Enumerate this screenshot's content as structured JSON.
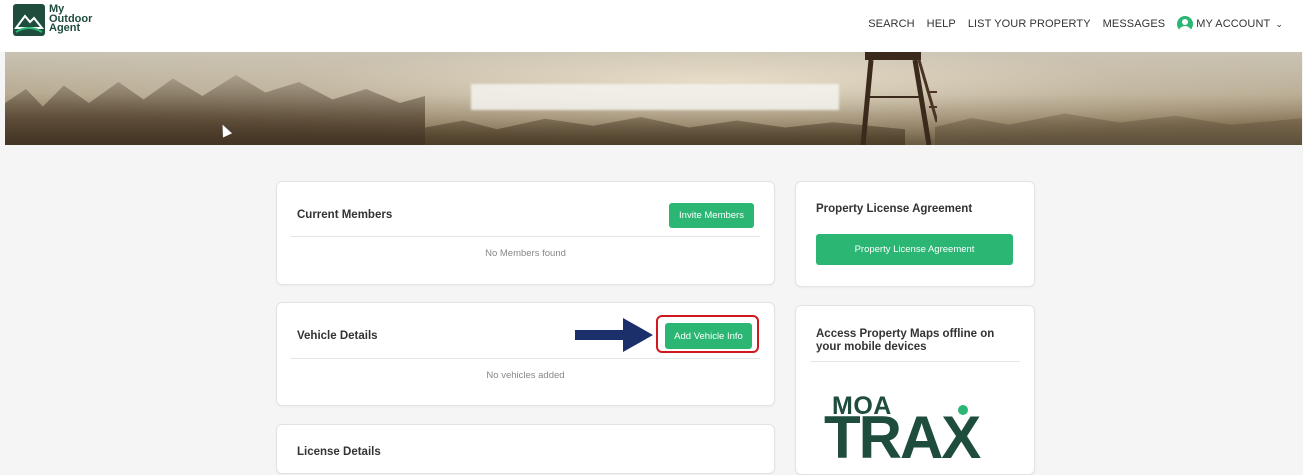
{
  "header": {
    "logo_text": [
      "My",
      "Outdoor",
      "Agent"
    ],
    "nav": {
      "search": "SEARCH",
      "help": "HELP",
      "list_property": "LIST YOUR PROPERTY",
      "messages": "MESSAGES",
      "account": "MY ACCOUNT"
    }
  },
  "members_card": {
    "title": "Current Members",
    "button": "Invite Members",
    "empty": "No Members found"
  },
  "vehicle_card": {
    "title": "Vehicle Details",
    "button": "Add Vehicle Info",
    "empty": "No vehicles added"
  },
  "license_card": {
    "title": "License Details"
  },
  "agreement_card": {
    "title": "Property License Agreement",
    "button": "Property License Agreement"
  },
  "offline_card": {
    "title": "Access Property Maps offline on your mobile devices",
    "app_logo_top": "MOA",
    "app_logo_bottom": "TRAX"
  },
  "colors": {
    "accent": "#2bb673",
    "brand_dark": "#1f4d3d",
    "highlight": "#d0191f",
    "arrow": "#1b2f6b"
  }
}
